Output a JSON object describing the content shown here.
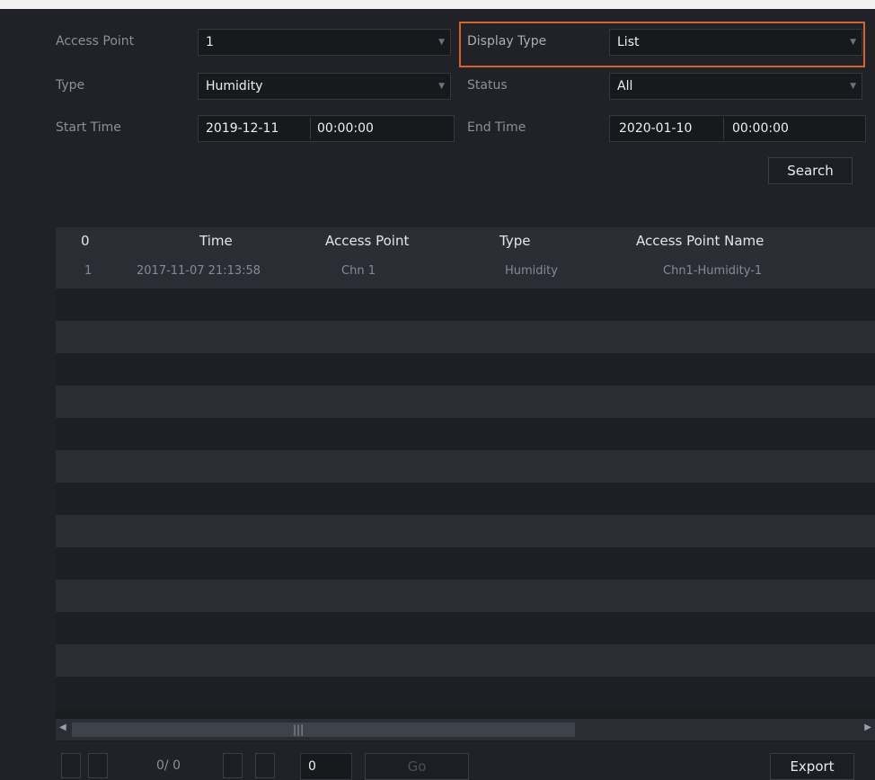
{
  "filters": {
    "access_point": {
      "label": "Access Point",
      "value": "1"
    },
    "display_type": {
      "label": "Display Type",
      "value": "List"
    },
    "type": {
      "label": "Type",
      "value": "Humidity"
    },
    "status": {
      "label": "Status",
      "value": "All"
    },
    "start_time": {
      "label": "Start Time",
      "date": "2019-12-11",
      "time": "00:00:00"
    },
    "end_time": {
      "label": "End Time",
      "date": "2020-01-10",
      "time": "00:00:00"
    },
    "search_label": "Search"
  },
  "table": {
    "columns": [
      "0",
      "Time",
      "Access Point",
      "Type",
      "Access Point Name"
    ],
    "rows": [
      {
        "index": "1",
        "time": "2017-11-07 21:13:58",
        "access_point": "Chn 1",
        "type": "Humidity",
        "name": "Chn1-Humidity-1"
      }
    ]
  },
  "footer": {
    "page_info": "0/ 0",
    "page_input": "0",
    "go_label": "Go",
    "export_label": "Export"
  },
  "colors": {
    "highlight": "#d9612f",
    "background": "#202227"
  }
}
